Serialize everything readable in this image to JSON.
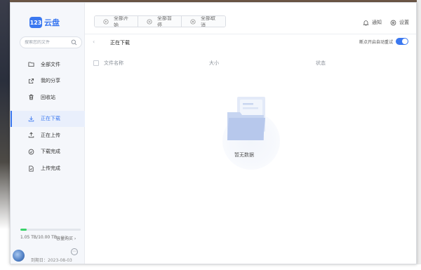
{
  "app": {
    "logo_badge": "123",
    "logo_text": "云盘"
  },
  "sidebar": {
    "search_placeholder": "搜索您的文件",
    "items": [
      {
        "label": "全部文件",
        "icon": "folder-icon"
      },
      {
        "label": "我的分享",
        "icon": "share-icon"
      },
      {
        "label": "回收站",
        "icon": "trash-icon"
      },
      {
        "label": "正在下载",
        "icon": "download-icon",
        "active": true
      },
      {
        "label": "正在上传",
        "icon": "upload-icon"
      },
      {
        "label": "下载完成",
        "icon": "check-circle-icon"
      },
      {
        "label": "上传完成",
        "icon": "file-check-icon"
      }
    ],
    "storage_text": "1.05 TB/10.00 TB",
    "storage_used_fraction": 0.105,
    "buy_link": "容量购买 ›",
    "expire_text": "到期日：2023-08-03",
    "more": "⋯"
  },
  "toolbar": {
    "start_all": "全部开始",
    "pause_all": "全部暂停",
    "cancel_all": "全部取消"
  },
  "header": {
    "notify": "通知",
    "settings": "设置"
  },
  "main": {
    "back": "‹",
    "title": "正在下载",
    "auto_retry_label": "断点开启自动重试",
    "auto_retry_on": true,
    "columns": [
      "文件名称",
      "大小",
      "状态"
    ],
    "empty_text": "暂无数据"
  },
  "colors": {
    "accent": "#3b78f0",
    "storage": "#3ad26a"
  }
}
